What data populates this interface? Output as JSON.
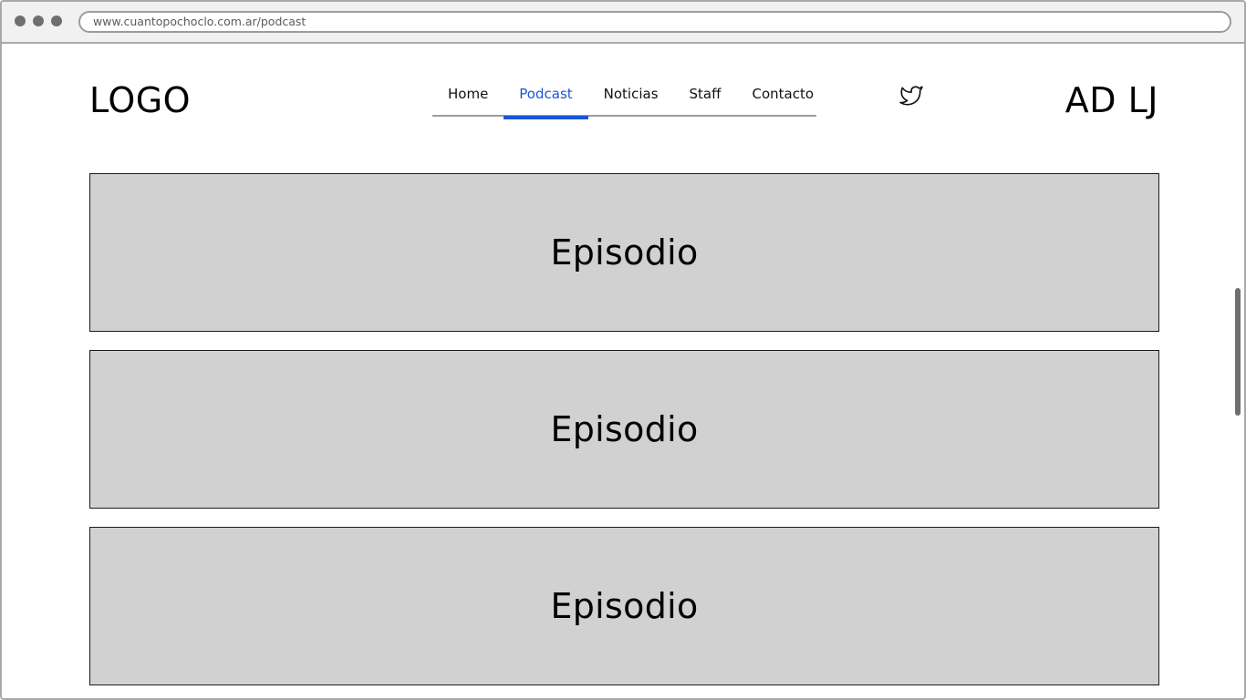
{
  "browser": {
    "url": "www.cuantopochoclo.com.ar/podcast"
  },
  "header": {
    "logo": "LOGO",
    "initials": "AD LJ",
    "social_icon": "twitter-icon"
  },
  "nav": {
    "active_color": "#1a56d6",
    "items": [
      {
        "label": "Home",
        "active": false
      },
      {
        "label": "Podcast",
        "active": true
      },
      {
        "label": "Noticias",
        "active": false
      },
      {
        "label": "Staff",
        "active": false
      },
      {
        "label": "Contacto",
        "active": false
      }
    ]
  },
  "episodes": [
    {
      "title": "Episodio"
    },
    {
      "title": "Episodio"
    },
    {
      "title": "Episodio"
    }
  ],
  "colors": {
    "episode_bg": "#d1d1d1",
    "frame": "#a9a9a9"
  }
}
